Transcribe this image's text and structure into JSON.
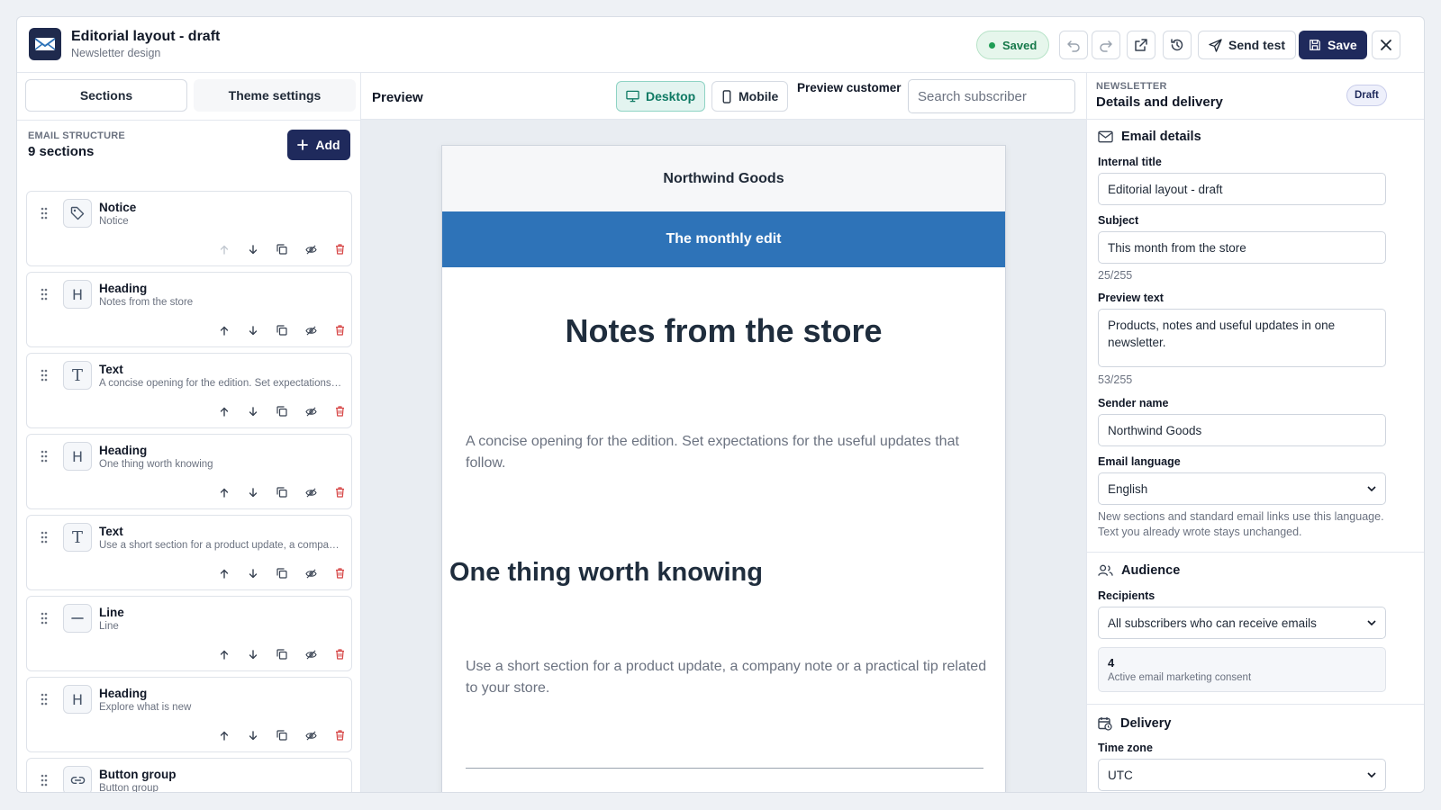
{
  "header": {
    "title": "Editorial layout - draft",
    "subtitle": "Newsletter design",
    "saved_label": "Saved",
    "send_test_label": "Send test",
    "save_label": "Save"
  },
  "left": {
    "tabs": [
      "Sections",
      "Theme settings"
    ],
    "structure_label": "EMAIL STRUCTURE",
    "section_count": "9 sections",
    "add_label": "Add",
    "sections": [
      {
        "icon": "tag-icon",
        "title": "Notice",
        "subtitle": "Notice"
      },
      {
        "icon": "heading-icon",
        "title": "Heading",
        "subtitle": "Notes from the store"
      },
      {
        "icon": "text-icon",
        "title": "Text",
        "subtitle": "A concise opening for the edition. Set expectations for the useful updates that follow."
      },
      {
        "icon": "heading-icon",
        "title": "Heading",
        "subtitle": "One thing worth knowing"
      },
      {
        "icon": "text-icon",
        "title": "Text",
        "subtitle": "Use a short section for a product update, a company note or a practical tip related to your store."
      },
      {
        "icon": "line-icon",
        "title": "Line",
        "subtitle": "Line"
      },
      {
        "icon": "heading-icon",
        "title": "Heading",
        "subtitle": "Explore what is new"
      },
      {
        "icon": "link-icon",
        "title": "Button group",
        "subtitle": "Button group"
      }
    ]
  },
  "preview": {
    "label": "Preview",
    "desktop_label": "Desktop",
    "mobile_label": "Mobile",
    "customer_label": "Preview customer",
    "search_placeholder": "Search subscriber",
    "email": {
      "brand": "Northwind Goods",
      "notice": "The monthly edit",
      "heading1": "Notes from the store",
      "text1": "A concise opening for the edition. Set expectations for the useful updates that follow.",
      "heading2": "One thing worth knowing",
      "text2": "Use a short section for a product update, a company note or a practical tip related to your store."
    }
  },
  "right": {
    "overline": "NEWSLETTER",
    "title": "Details and delivery",
    "status": "Draft",
    "email_details": {
      "heading": "Email details",
      "internal_title_label": "Internal title",
      "internal_title_value": "Editorial layout - draft",
      "subject_label": "Subject",
      "subject_value": "This month from the store",
      "subject_count": "25/255",
      "preview_text_label": "Preview text",
      "preview_text_value": "Products, notes and useful updates in one newsletter.",
      "preview_text_count": "53/255",
      "sender_name_label": "Sender name",
      "sender_name_value": "Northwind Goods",
      "language_label": "Email language",
      "language_value": "English",
      "language_help": "New sections and standard email links use this language. Text you already wrote stays unchanged."
    },
    "audience": {
      "heading": "Audience",
      "recipients_label": "Recipients",
      "recipients_value": "All subscribers who can receive emails",
      "count": "4",
      "count_label": "Active email marketing consent"
    },
    "delivery": {
      "heading": "Delivery",
      "timezone_label": "Time zone",
      "timezone_value": "UTC"
    }
  },
  "colors": {
    "primary": "#1f2a5c",
    "accent_teal": "#0f7a64",
    "notice_blue": "#2e73b8",
    "success": "#16794a",
    "danger": "#d64545"
  }
}
